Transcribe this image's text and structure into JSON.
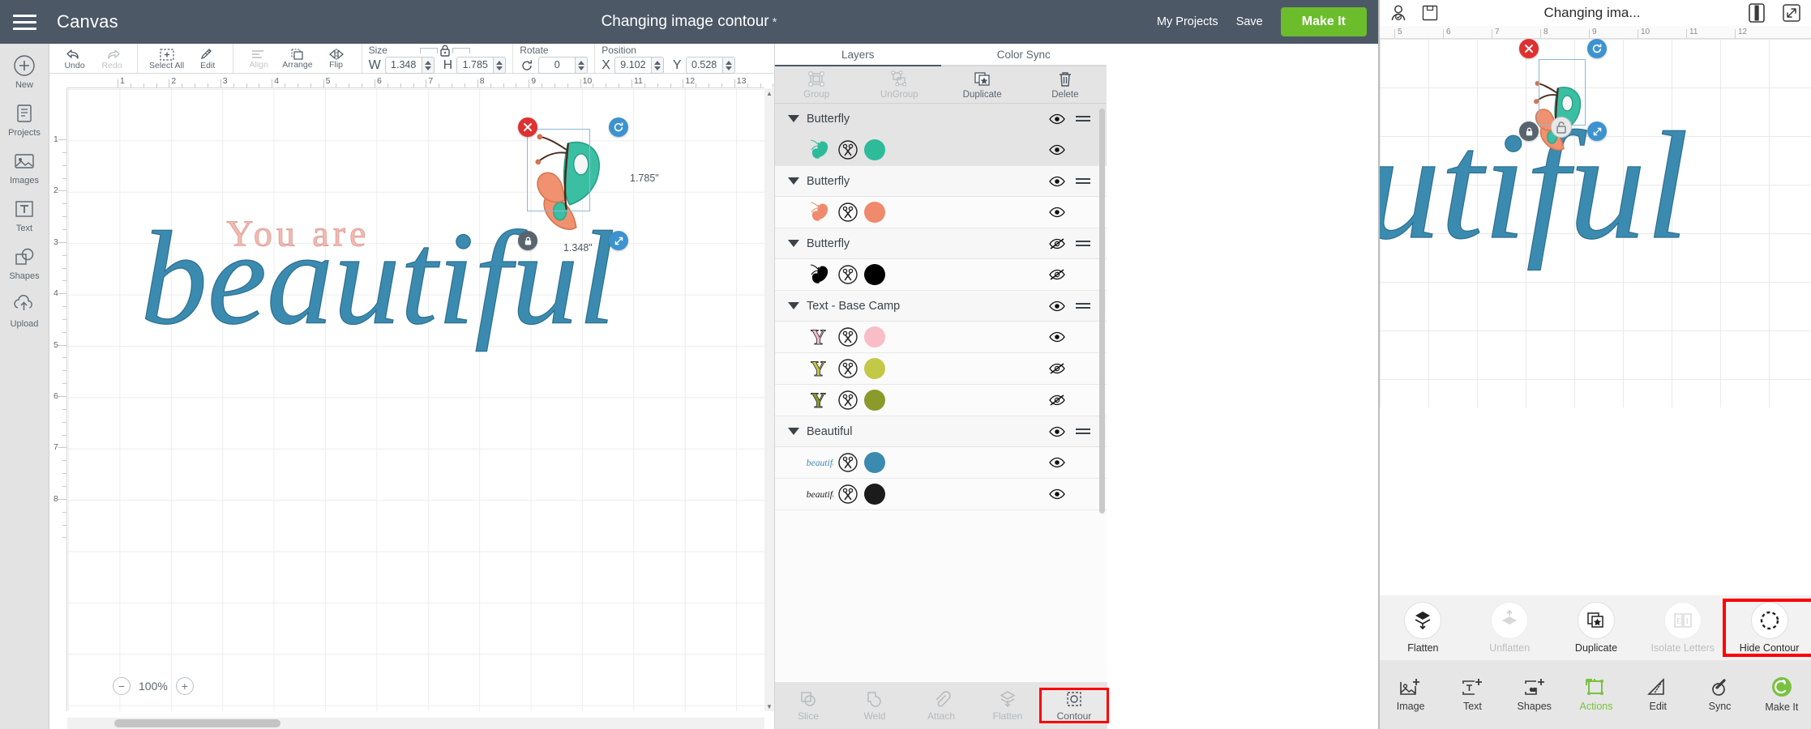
{
  "header": {
    "menu_icon": "hamburger-icon",
    "canvas_label": "Canvas",
    "document_title": "Changing image contour",
    "unsaved_marker": "*",
    "my_projects": "My Projects",
    "save": "Save",
    "make_it": "Make It",
    "accent_green": "#6bbd2b",
    "bar_color": "#4c5866"
  },
  "rail": {
    "items": [
      {
        "label": "New",
        "icon": "plus-circle-icon"
      },
      {
        "label": "Projects",
        "icon": "projects-icon"
      },
      {
        "label": "Images",
        "icon": "images-icon"
      },
      {
        "label": "Text",
        "icon": "text-icon"
      },
      {
        "label": "Shapes",
        "icon": "shapes-icon"
      },
      {
        "label": "Upload",
        "icon": "upload-icon"
      }
    ]
  },
  "toolbar": {
    "undo": "Undo",
    "redo": "Redo",
    "select_all": "Select All",
    "edit": "Edit",
    "align": "Align",
    "arrange": "Arrange",
    "flip": "Flip",
    "size_label": "Size",
    "w_label": "W",
    "w_value": "1.348",
    "h_label": "H",
    "h_value": "1.785",
    "rotate_label": "Rotate",
    "rotate_value": "0",
    "position_label": "Position",
    "x_label": "X",
    "x_value": "9.102",
    "y_label": "Y",
    "y_value": "0.528",
    "lock_icon": "lock-closed-icon"
  },
  "canvas": {
    "zoom_level": "100%",
    "zoom_out": "−",
    "zoom_in": "+",
    "ruler_h": [
      "1",
      "2",
      "3",
      "4",
      "5",
      "6",
      "7",
      "8",
      "9",
      "10",
      "11",
      "12",
      "13"
    ],
    "ruler_v": [
      "1",
      "2",
      "3",
      "4",
      "5",
      "6",
      "7",
      "8"
    ],
    "selection": {
      "width_label": "1.348\"",
      "height_label": "1.785\"",
      "delete_icon": "close-x-icon",
      "rotate_icon": "rotate-icon",
      "lock_icon": "lock-closed-icon",
      "resize_icon": "resize-diagonal-icon"
    },
    "text_top": "You are",
    "text_main": "beautiful",
    "text_top_color": "#f4b9b0",
    "text_main_color": "#3b8bb0"
  },
  "layers": {
    "tabs": [
      {
        "label": "Layers",
        "active": true
      },
      {
        "label": "Color Sync",
        "active": false
      }
    ],
    "actions": [
      {
        "label": "Group",
        "icon": "group-icon",
        "disabled": true
      },
      {
        "label": "UnGroup",
        "icon": "ungroup-icon",
        "disabled": true
      },
      {
        "label": "Duplicate",
        "icon": "duplicate-icon",
        "disabled": false
      },
      {
        "label": "Delete",
        "icon": "trash-icon",
        "disabled": false
      }
    ],
    "list": [
      {
        "type": "group",
        "name": "Butterfly",
        "visible": true,
        "selected": true
      },
      {
        "type": "layer",
        "thumb": "butterfly-teal",
        "color": "#2dbb9a",
        "visible": true,
        "selected": true
      },
      {
        "type": "group",
        "name": "Butterfly",
        "visible": true,
        "selected": false
      },
      {
        "type": "layer",
        "thumb": "butterfly-salmon",
        "color": "#f08a6c",
        "visible": true,
        "selected": false
      },
      {
        "type": "group",
        "name": "Butterfly",
        "visible": false,
        "selected": false
      },
      {
        "type": "layer",
        "thumb": "butterfly-black",
        "color": "#000000",
        "visible": false,
        "selected": false
      },
      {
        "type": "group",
        "name": "Text - Base Camp",
        "visible": true,
        "selected": false
      },
      {
        "type": "layer",
        "thumb": "letter-Y-pink",
        "color": "#f9bdc8",
        "visible": true,
        "selected": false
      },
      {
        "type": "layer",
        "thumb": "letter-Y-yellow",
        "color": "#c3c846",
        "visible": false,
        "selected": false
      },
      {
        "type": "layer",
        "thumb": "letter-Y-olive",
        "color": "#8a9a2b",
        "visible": false,
        "selected": false
      },
      {
        "type": "group",
        "name": "Beautiful",
        "visible": true,
        "selected": false
      },
      {
        "type": "layer",
        "thumb": "script-beautiful-blue",
        "color": "#3b8bb0",
        "visible": true,
        "selected": false
      },
      {
        "type": "layer",
        "thumb": "script-beautiful-black",
        "color": "#1b1b1b",
        "visible": true,
        "selected": false
      }
    ],
    "bottom_bar": [
      {
        "label": "Slice",
        "icon": "slice-icon",
        "disabled": true,
        "highlighted": false
      },
      {
        "label": "Weld",
        "icon": "weld-icon",
        "disabled": true,
        "highlighted": false
      },
      {
        "label": "Attach",
        "icon": "attach-paperclip-icon",
        "disabled": true,
        "highlighted": false
      },
      {
        "label": "Flatten",
        "icon": "flatten-icon",
        "disabled": true,
        "highlighted": false
      },
      {
        "label": "Contour",
        "icon": "contour-icon",
        "disabled": false,
        "highlighted": true
      }
    ]
  },
  "mobile": {
    "account_icon": "user-account-icon",
    "save_icon": "floppy-save-icon",
    "title": "Changing ima...",
    "panel_toggle_icon": "split-panel-icon",
    "expand_icon": "expand-arrows-icon",
    "ruler": [
      "5",
      "6",
      "7",
      "8",
      "9",
      "10",
      "11",
      "12"
    ],
    "text_main": "utiful",
    "selection": {
      "delete_icon": "close-x-icon",
      "rotate_icon": "rotate-icon",
      "lock_icon": "lock-closed-icon",
      "unlock_icon": "lock-open-icon",
      "resize_icon": "resize-diagonal-icon"
    },
    "actions": [
      {
        "label": "Flatten",
        "icon": "flatten-icon",
        "disabled": false,
        "highlighted": false
      },
      {
        "label": "Unflatten",
        "icon": "unflatten-icon",
        "disabled": true,
        "highlighted": false
      },
      {
        "label": "Duplicate",
        "icon": "duplicate-star-icon",
        "disabled": false,
        "highlighted": false
      },
      {
        "label": "Isolate Letters",
        "icon": "isolate-letters-icon",
        "disabled": true,
        "highlighted": false
      },
      {
        "label": "Hide Contour",
        "icon": "contour-dashed-circle-icon",
        "disabled": false,
        "highlighted": true
      }
    ],
    "nav": [
      {
        "label": "Image",
        "icon": "image-plus-icon",
        "active": false
      },
      {
        "label": "Text",
        "icon": "text-plus-icon",
        "active": false
      },
      {
        "label": "Shapes",
        "icon": "shapes-plus-icon",
        "active": false
      },
      {
        "label": "Actions",
        "icon": "actions-icon",
        "active": true
      },
      {
        "label": "Edit",
        "icon": "edit-ruler-icon",
        "active": false
      },
      {
        "label": "Sync",
        "icon": "sync-icon",
        "active": false
      },
      {
        "label": "Make It",
        "icon": "cricut-c-icon",
        "active": false
      }
    ],
    "accent_green": "#7ac143"
  }
}
